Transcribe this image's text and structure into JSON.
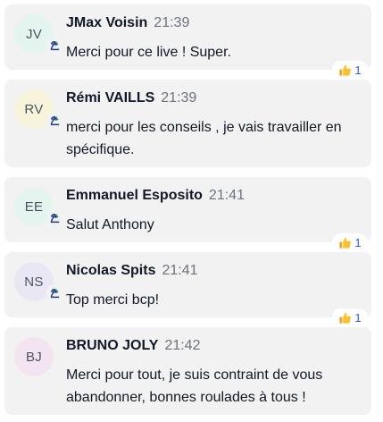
{
  "messages": [
    {
      "initials": "JV",
      "name": "JMax Voisin",
      "time": "21:39",
      "text": "Merci pour ce live ! Super.",
      "avatar_color": "#e4f4ee",
      "reaction_count": "1"
    },
    {
      "initials": "RV",
      "name": "Rémi VAILLS",
      "time": "21:39",
      "text": "merci pour les conseils , je vais travailler en spécifique.",
      "avatar_color": "#f7f4db",
      "reaction_count": ""
    },
    {
      "initials": "EE",
      "name": "Emmanuel Esposito",
      "time": "21:41",
      "text": "Salut Anthony",
      "avatar_color": "#e4f4ee",
      "reaction_count": "1"
    },
    {
      "initials": "NS",
      "name": "Nicolas Spits",
      "time": "21:41",
      "text": "Top merci bcp!",
      "avatar_color": "#e9e7f4",
      "reaction_count": "1"
    },
    {
      "initials": "BJ",
      "name": "BRUNO JOLY",
      "time": "21:42",
      "text": "Merci pour tout, je suis contraint de vous abandonner, bonnes roulades à tous !",
      "avatar_color": "#f4e4f1",
      "reaction_count": ""
    }
  ],
  "icons": {
    "badge": "chess-knight-icon",
    "reaction": "thumbs-up-icon"
  }
}
